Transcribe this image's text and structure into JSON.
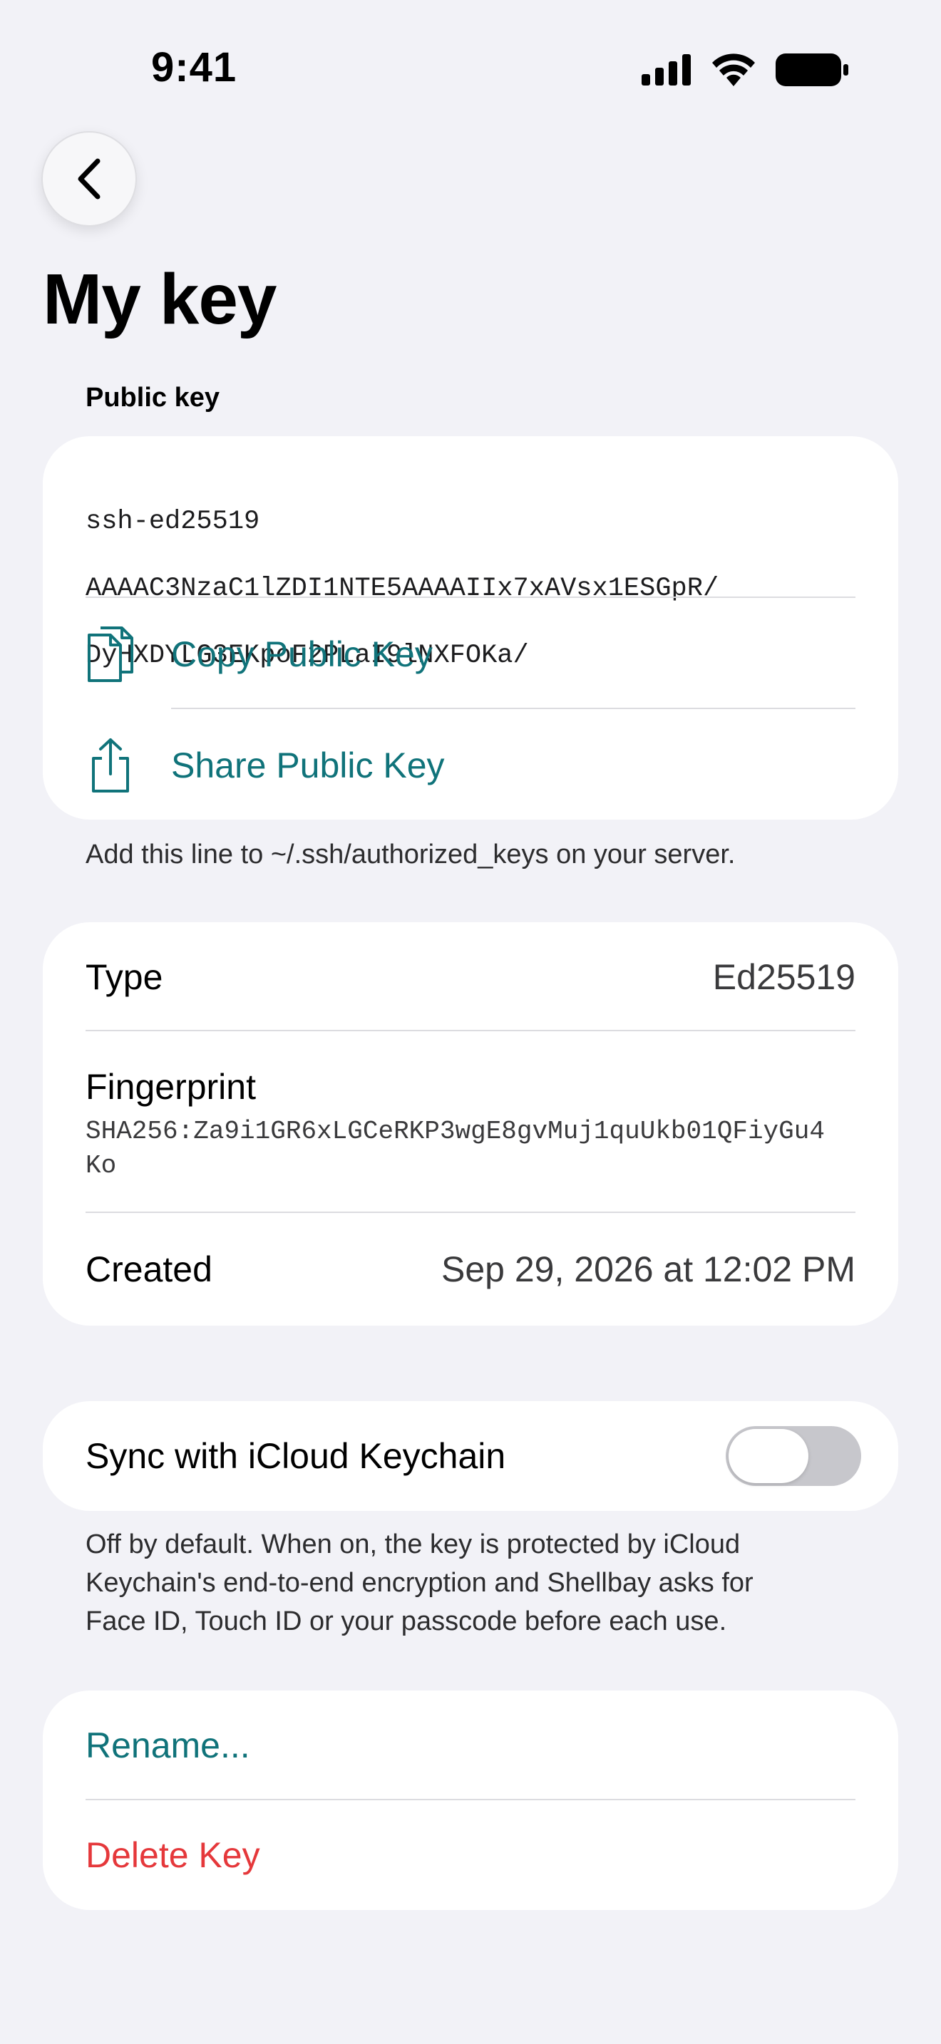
{
  "status_bar": {
    "time": "9:41"
  },
  "nav": {
    "back_icon": "chevron-left-icon"
  },
  "page": {
    "title": "My key"
  },
  "public_key_section": {
    "header": "Public key",
    "key_line1": "ssh-ed25519",
    "key_line2": "AAAAC3NzaC1lZDI1NTE5AAAAIIx7xAVsx1ESGpR/",
    "key_line3": "DyHXDYLG3EKpoF2PLaI9lNXFOKa/",
    "copy_label": "Copy Public Key",
    "share_label": "Share Public Key",
    "footnote": "Add this line to ~/.ssh/authorized_keys on your server."
  },
  "details_section": {
    "type_label": "Type",
    "type_value": "Ed25519",
    "fingerprint_label": "Fingerprint",
    "fingerprint_line1": "SHA256:Za9i1GR6xLGCeRKP3wgE8gvMuj1quUkb01QFiyGu4",
    "fingerprint_line2": "Ko",
    "created_label": "Created",
    "created_value": "Sep 29, 2026 at 12:02 PM"
  },
  "sync_section": {
    "label": "Sync with iCloud Keychain",
    "enabled": false,
    "footnote_line1": "Off by default. When on, the key is protected by iCloud",
    "footnote_line2": "Keychain's end-to-end encryption and Shellbay asks for",
    "footnote_line3": "Face ID, Touch ID or your passcode before each use."
  },
  "actions_section": {
    "rename_label": "Rename...",
    "delete_label": "Delete Key"
  },
  "colors": {
    "accent": "#10737a",
    "destructive": "#e5383b",
    "background": "#f2f2f7",
    "card": "#ffffff"
  }
}
